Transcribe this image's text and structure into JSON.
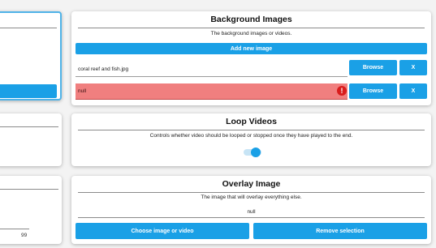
{
  "left_panel": {
    "bottom_value": "99"
  },
  "background_images": {
    "title": "Background Images",
    "description": "The background images or videos.",
    "add_button": "Add new image",
    "rows": [
      {
        "value": "coral reef and fish.jpg",
        "browse_label": "Browse",
        "remove_label": "X",
        "error": false
      },
      {
        "value": "null",
        "browse_label": "Browse",
        "remove_label": "X",
        "error": true
      }
    ],
    "error_icon": "exclamation-circle-icon"
  },
  "loop_videos": {
    "title": "Loop Videos",
    "description": "Controls whether video should be looped or stopped once they have played to the end.",
    "toggle_state": "on"
  },
  "overlay_image": {
    "title": "Overlay Image",
    "description": "The image that will overlay everything else.",
    "value": "null",
    "choose_button": "Choose image or video",
    "remove_button": "Remove selection"
  },
  "colors": {
    "accent": "#1aa0e6",
    "error_bg": "#f07f7f",
    "error_icon": "#d91c1c",
    "focus_border": "#4fb3e8"
  }
}
